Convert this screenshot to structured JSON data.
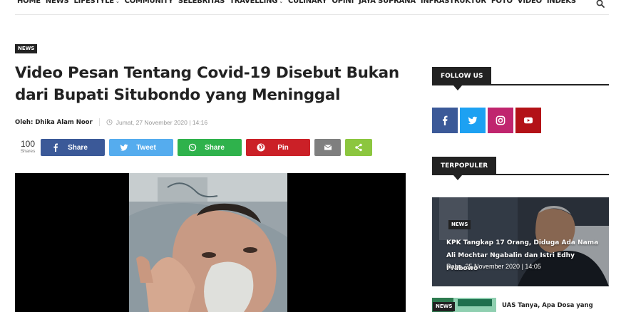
{
  "nav": {
    "items": [
      {
        "label": "HOME",
        "dropdown": false
      },
      {
        "label": "NEWS",
        "dropdown": false
      },
      {
        "label": "LIFESTYLE",
        "dropdown": true
      },
      {
        "label": "COMMUNITY",
        "dropdown": false
      },
      {
        "label": "SELEBRITAS",
        "dropdown": false
      },
      {
        "label": "TRAVELLING",
        "dropdown": true
      },
      {
        "label": "CULINARY",
        "dropdown": false
      },
      {
        "label": "OPINI",
        "dropdown": false
      },
      {
        "label": "JAYA SUPRANA",
        "dropdown": false
      },
      {
        "label": "INFRASTRUKTUR",
        "dropdown": false
      },
      {
        "label": "FOTO",
        "dropdown": false
      },
      {
        "label": "VIDEO",
        "dropdown": false
      },
      {
        "label": "INDEKS",
        "dropdown": false
      }
    ],
    "search_icon": "search-icon"
  },
  "article": {
    "category": "NEWS",
    "title": "Video Pesan Tentang Covid-19 Disebut Bukan dari Bupati Situbondo yang Meninggal",
    "author": "Oleh: Dhika Alam Noor",
    "date": "Jumat, 27 November 2020 | 14:16",
    "share_count": "100",
    "share_count_label": "Shares"
  },
  "share_buttons": {
    "facebook": "Share",
    "twitter": "Tweet",
    "whatsapp": "Share",
    "pinterest": "Pin"
  },
  "sidebar": {
    "follow_title": "FOLLOW US",
    "popular_title": "TERPOPULER",
    "social": [
      "facebook-icon",
      "twitter-icon",
      "instagram-icon",
      "youtube-icon"
    ],
    "featured": {
      "category": "NEWS",
      "title": "KPK Tangkap 17 Orang, Diduga Ada Nama Ali Mochtar Ngabalin dan Istri Edhy Prabowo",
      "date": "Rabu, 25 November 2020 | 14:05"
    },
    "second": {
      "category": "NEWS",
      "title": "UAS Tanya, Apa Dosa yang"
    }
  },
  "colors": {
    "facebook": "#3b5998",
    "twitter": "#55acee",
    "whatsapp": "#2fb24c",
    "pinterest": "#cb2027",
    "email": "#7f7f7f",
    "share_more": "#8cc63f",
    "instagram": "#c0256e",
    "youtube": "#b31217",
    "dark": "#222222"
  }
}
